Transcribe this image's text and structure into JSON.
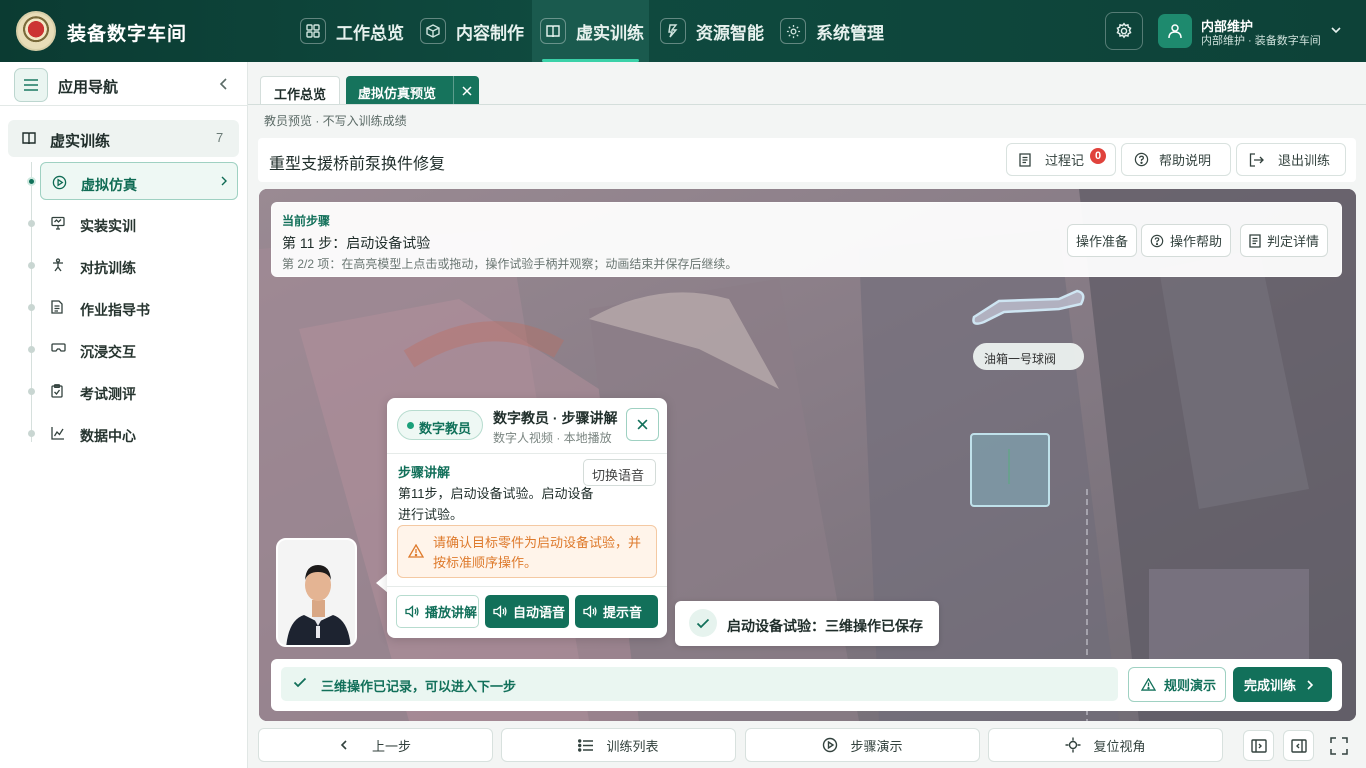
{
  "header": {
    "app_title": "装备数字车间",
    "nav": [
      {
        "label": "工作总览",
        "icon": "grid-icon"
      },
      {
        "label": "内容制作",
        "icon": "cube-icon"
      },
      {
        "label": "虚实训练",
        "icon": "book-icon",
        "active": true
      },
      {
        "label": "资源智能",
        "icon": "spark-icon"
      },
      {
        "label": "系统管理",
        "icon": "gear-icon"
      }
    ],
    "user": {
      "name": "内部维护",
      "subtitle": "内部维护 · 装备数字车间"
    }
  },
  "sidebar": {
    "title": "应用导航",
    "group": {
      "label": "虚实训练",
      "count": "7"
    },
    "items": [
      {
        "label": "虚拟仿真",
        "icon": "play-circle-icon",
        "active": true
      },
      {
        "label": "实装实训",
        "icon": "monitor-icon"
      },
      {
        "label": "对抗训练",
        "icon": "fight-icon"
      },
      {
        "label": "作业指导书",
        "icon": "document-icon"
      },
      {
        "label": "沉浸交互",
        "icon": "vr-icon"
      },
      {
        "label": "考试测评",
        "icon": "clipboard-icon"
      },
      {
        "label": "数据中心",
        "icon": "chart-icon"
      }
    ]
  },
  "tabs": [
    {
      "label": "工作总览"
    },
    {
      "label": "虚拟仿真预览",
      "active": true
    }
  ],
  "preview_note": "教员预览 · 不写入训练成绩",
  "page": {
    "title": "重型支援桥前泵换件修复",
    "actions": {
      "process_log": "过程记",
      "process_badge": "0",
      "help": "帮助说明",
      "exit": "退出训练"
    }
  },
  "step": {
    "caption": "当前步骤",
    "title": "第 11 步：启动设备试验",
    "desc": "第 2/2 项：在高亮模型上点击或拖动，操作试验手柄并观察；动画结束并保存后继续。",
    "buttons": {
      "prepare": "操作准备",
      "help": "操作帮助",
      "detail": "判定详情"
    }
  },
  "scene": {
    "part_label": "油箱一号球阀"
  },
  "coach": {
    "tag": "数字教员",
    "name": "数字教员 · 步骤讲解",
    "subtitle": "数字人视频 · 本地播放",
    "explain_heading": "步骤讲解",
    "switch_voice": "切换语音",
    "explain_text": "第11步，启动设备试验。启动设备进行试验。",
    "warning": "请确认目标零件为启动设备试验，并按标准顺序操作。",
    "buttons": {
      "play": "播放讲解",
      "auto": "自动语音",
      "tip": "提示音"
    }
  },
  "toast": {
    "text": "启动设备试验：三维操作已保存"
  },
  "status": {
    "text": "三维操作已记录，可以进入下一步",
    "rule_demo": "规则演示",
    "finish": "完成训练"
  },
  "footer": {
    "prev": "上一步",
    "list": "训练列表",
    "demo": "步骤演示",
    "reset_view": "复位视角"
  },
  "colors": {
    "brand": "#0f4a3f",
    "accent": "#12705a",
    "warning": "#de7a2c",
    "badge": "#e0423c"
  }
}
